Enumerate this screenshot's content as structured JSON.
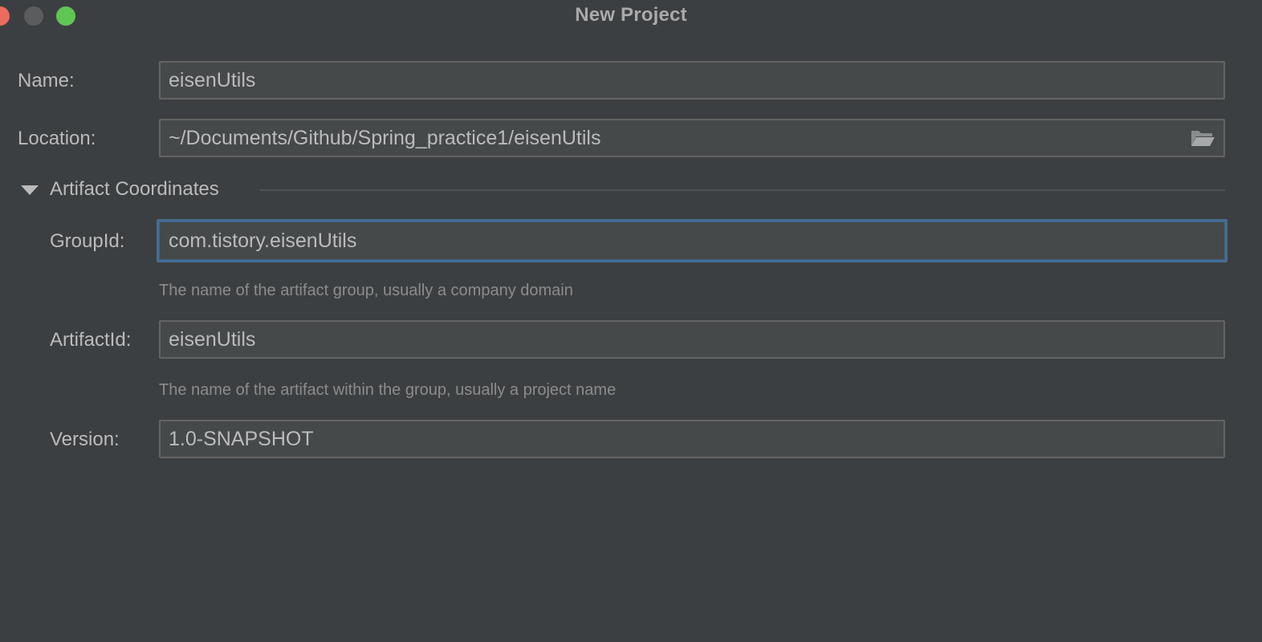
{
  "window": {
    "title": "New Project"
  },
  "form": {
    "name": {
      "label": "Name:",
      "value": "eisenUtils"
    },
    "location": {
      "label": "Location:",
      "value": "~/Documents/Github/Spring_practice1/eisenUtils",
      "browse_icon": "folder-open-icon"
    },
    "artifact_section": {
      "label": "Artifact Coordinates",
      "expanded": true
    },
    "group_id": {
      "label": "GroupId:",
      "value": "com.tistory.eisenUtils",
      "hint": "The name of the artifact group, usually a company domain"
    },
    "artifact_id": {
      "label": "ArtifactId:",
      "value": "eisenUtils",
      "hint": "The name of the artifact within the group, usually a project name"
    },
    "version": {
      "label": "Version:",
      "value": "1.0-SNAPSHOT"
    }
  },
  "colors": {
    "background": "#3c3f41",
    "field_background": "#45494a",
    "focus_border": "#466d94",
    "close": "#ed6a5e",
    "minimize": "#5a5c5e",
    "zoom": "#61c554"
  }
}
